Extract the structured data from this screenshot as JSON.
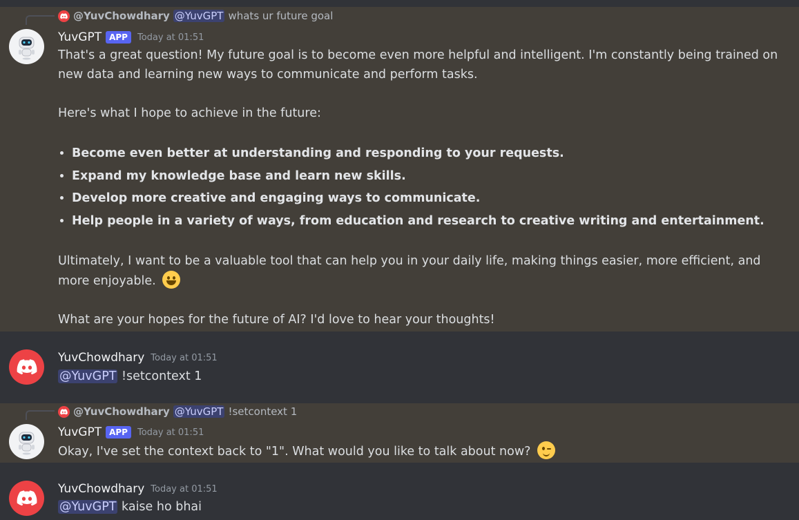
{
  "messages": [
    {
      "reply": {
        "author": "@YuvChowdhary",
        "mention": "@YuvGPT",
        "text": "whats ur future goal"
      },
      "author": "YuvGPT",
      "tag": "APP",
      "time": "Today at 01:51",
      "intro": "That's a great question!  My future goal is to become even more helpful and intelligent. I'm constantly being trained on new data and learning new ways to communicate and perform tasks.",
      "lead": "Here's what I hope to achieve in the future:",
      "bullets": [
        "Become even better at understanding and responding to your requests.",
        "Expand my knowledge base and learn new skills.",
        "Develop more creative and engaging ways to communicate.",
        "Help people in a variety of ways, from education and research to creative writing and entertainment."
      ],
      "closing": "Ultimately, I want to be a valuable tool that can help you in your daily life, making things easier, more efficient, and more enjoyable.",
      "closing_emoji": "grinning-face-emoji",
      "question": "What are your hopes for the future of AI?  I'd love to hear your thoughts!"
    },
    {
      "author": "YuvChowdhary",
      "time": "Today at 01:51",
      "mention": "@YuvGPT",
      "text": "!setcontext 1"
    },
    {
      "reply": {
        "author": "@YuvChowdhary",
        "mention": "@YuvGPT",
        "text": "!setcontext 1"
      },
      "author": "YuvGPT",
      "tag": "APP",
      "time": "Today at 01:51",
      "text": "Okay, I've set the context back to \"1\".  What would you like to talk about now?",
      "emoji": "winking-face-emoji"
    },
    {
      "author": "YuvChowdhary",
      "time": "Today at 01:51",
      "mention": "@YuvGPT",
      "text": "kaise ho bhai"
    }
  ],
  "colors": {
    "highlight": "#433f39",
    "background": "#313338",
    "app_tag": "#5865f2",
    "discord_red": "#ed4245"
  }
}
